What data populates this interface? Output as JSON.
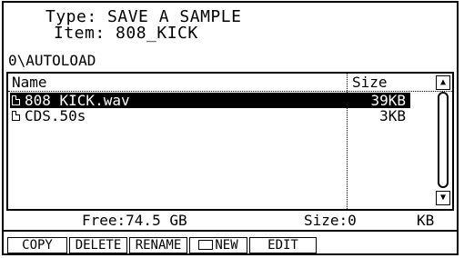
{
  "info": {
    "type_label": "Type:",
    "type_value": "SAVE A SAMPLE",
    "item_label": "Item:",
    "item_value": "808_KICK"
  },
  "path": "0\\AUTOLOAD",
  "columns": {
    "name": "Name",
    "size": "Size"
  },
  "files": [
    {
      "name": "808_KICK.wav",
      "size": "39KB",
      "selected": true,
      "icon": "file-icon"
    },
    {
      "name": "CDS.50s",
      "size": "3KB",
      "selected": false,
      "icon": "file-icon"
    }
  ],
  "scrollbar": {
    "up_icon": "scroll-up-icon",
    "down_icon": "scroll-down-icon"
  },
  "status": {
    "free": "Free:74.5 GB",
    "size": "Size:0",
    "unit": "KB"
  },
  "buttons": {
    "copy": "COPY",
    "delete": "DELETE",
    "rename": "RENAME",
    "new": "NEW",
    "edit": "EDIT",
    "new_icon": "folder-icon"
  }
}
